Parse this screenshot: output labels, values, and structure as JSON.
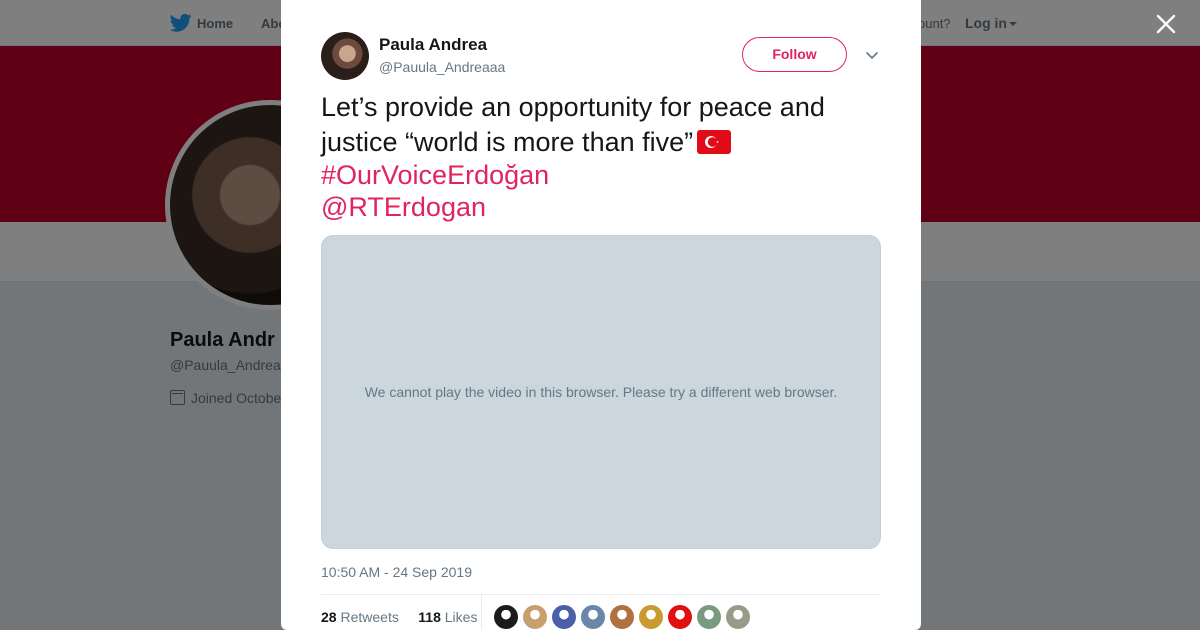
{
  "background": {
    "nav": {
      "home": "Home",
      "about": "Abo",
      "account_prompt": "ccount?",
      "login": "Log in"
    },
    "profile": {
      "name": "Paula Andr",
      "handle": "@Pauula_Andrea",
      "joined": "Joined Octobe"
    },
    "colors": {
      "banner": "#c1002b"
    }
  },
  "tweet": {
    "author_name": "Paula Andrea",
    "author_handle": "@Pauula_Andreaaa",
    "follow_label": "Follow",
    "text": "Let’s provide an opportunity for peace and justice “world is more than five”",
    "flag_icon": "turkey-flag-emoji",
    "hashtag": "#OurVoiceErdoğan",
    "mention": "@RTErdogan",
    "media_message": "We cannot play the video in this browser. Please try a different web browser.",
    "timestamp": "10:50 AM - 24 Sep 2019",
    "retweets_count": "28",
    "retweets_label": "Retweets",
    "likes_count": "118",
    "likes_label": "Likes",
    "liker_colors": [
      "#1b1b1b",
      "#c8a070",
      "#4a5fa8",
      "#6a86a8",
      "#b07040",
      "#c89a30",
      "#e01010",
      "#7a9a80",
      "#9a9a88"
    ],
    "accent_color": "#e0245e"
  }
}
